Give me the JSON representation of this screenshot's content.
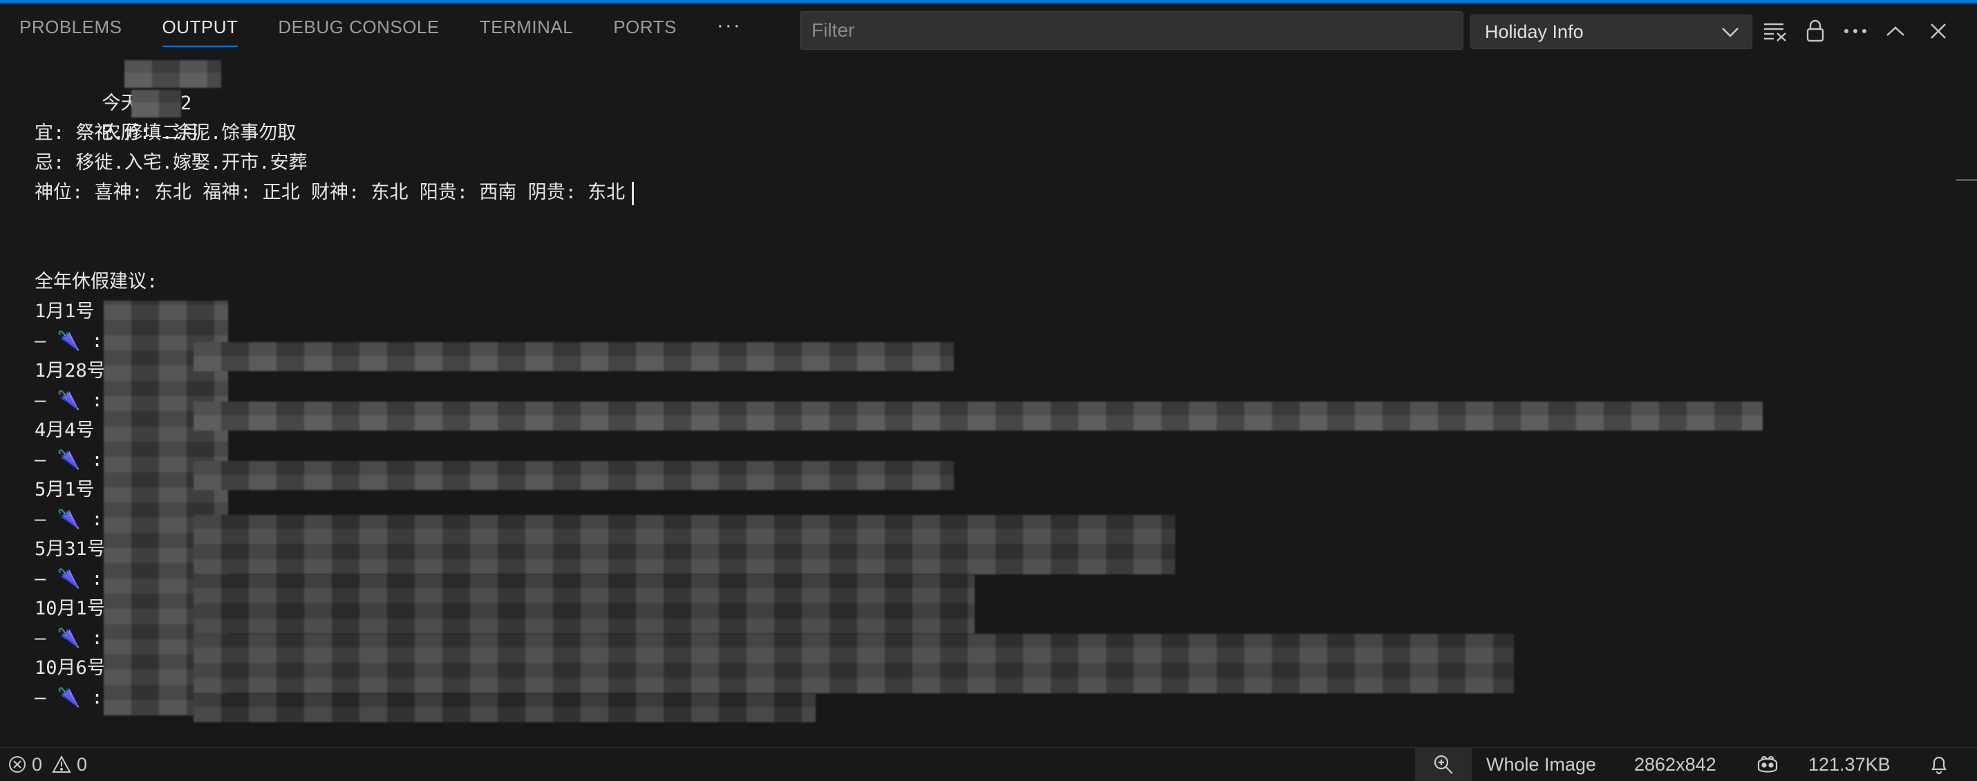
{
  "tabs": [
    {
      "label": "PROBLEMS"
    },
    {
      "label": "OUTPUT"
    },
    {
      "label": "DEBUG CONSOLE"
    },
    {
      "label": "TERMINAL"
    },
    {
      "label": "PORTS"
    }
  ],
  "more_tabs": "···",
  "filter": {
    "placeholder": "Filter",
    "value": ""
  },
  "channel_select": {
    "value": "Holiday Info"
  },
  "output": {
    "today": "今天是202",
    "lunar": "农历: 二月",
    "yi": "宜: 祭祀.修填.涂泥.馀事勿取",
    "ji": "忌: 移徙.入宅.嫁娶.开市.安葬",
    "shenwei": "神位: 喜神: 东北 福神: 正北 财神: 东北 阳贵: 西南 阴贵: 东北",
    "holiday_header": "全年休假建议:",
    "entries": [
      {
        "date": "1月1号"
      },
      {
        "date": "1月28号"
      },
      {
        "date": "4月4号"
      },
      {
        "date": "5月1号"
      },
      {
        "date": "5月31号"
      },
      {
        "date": "10月1号"
      },
      {
        "date": "10月6号"
      }
    ],
    "bullet_prefix": "— ",
    "bullet_suffix": " :",
    "umbrella": "🌂"
  },
  "statusbar": {
    "errors": "0",
    "warnings": "0",
    "image_label": "Whole Image",
    "dimensions": "2862x842",
    "filesize": "121.37KB"
  },
  "colors": {
    "accent": "#0078d4",
    "background": "#181818",
    "input_bg": "#313131"
  }
}
